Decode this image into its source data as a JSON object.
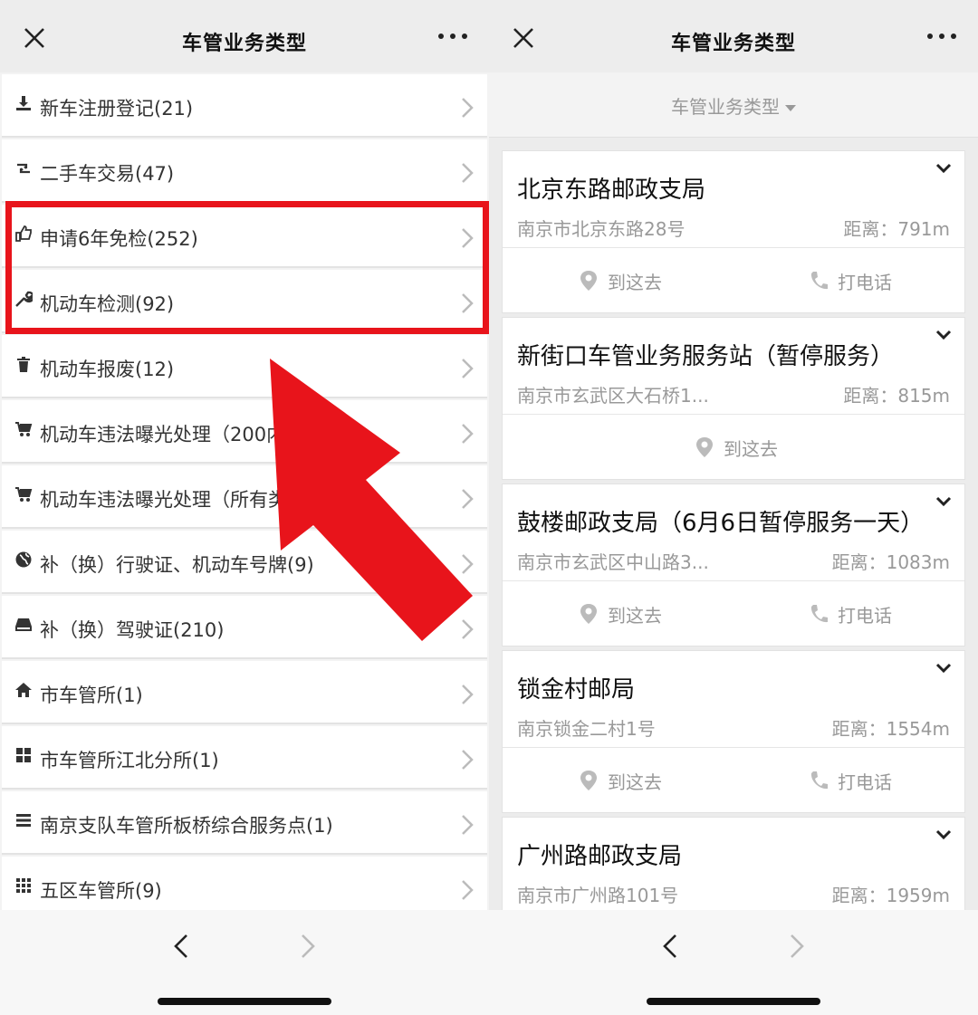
{
  "left": {
    "title": "车管业务类型",
    "items": [
      {
        "label": "新车注册登记(21)",
        "icon": "upload-icon"
      },
      {
        "label": "二手车交易(47)",
        "icon": "retweet-icon"
      },
      {
        "label": "申请6年免检(252)",
        "icon": "thumbs-up-icon"
      },
      {
        "label": "机动车检测(92)",
        "icon": "wrench-icon"
      },
      {
        "label": "机动车报废(12)",
        "icon": "trash-icon"
      },
      {
        "label": "机动车违法曝光处理（200内）(35)",
        "icon": "cart-icon"
      },
      {
        "label": "机动车违法曝光处理（所有类型）",
        "icon": "cart-icon"
      },
      {
        "label": "补（换）行驶证、机动车号牌(9)",
        "icon": "globe-icon"
      },
      {
        "label": "补（换）驾驶证(210)",
        "icon": "hdd-icon"
      },
      {
        "label": "市车管所(1)",
        "icon": "home-icon"
      },
      {
        "label": "市车管所江北分所(1)",
        "icon": "grid-icon"
      },
      {
        "label": "南京支队车管所板桥综合服务点(1)",
        "icon": "list-icon"
      },
      {
        "label": "五区车管所(9)",
        "icon": "grid-small-icon"
      }
    ]
  },
  "right": {
    "title": "车管业务类型",
    "filter_label": "车管业务类型",
    "go_label": "到这去",
    "call_label": "打电话",
    "cards": [
      {
        "name": "北京东路邮政支局",
        "address": "南京市北京东路28号",
        "distance": "距离：791m",
        "has_call": true
      },
      {
        "name": "新街口车管业务服务站（暂停服务）",
        "address": "南京市玄武区大石桥1...",
        "distance": "距离：815m",
        "has_call": false
      },
      {
        "name": "鼓楼邮政支局（6月6日暂停服务一天）",
        "address": "南京市玄武区中山路3...",
        "distance": "距离：1083m",
        "has_call": true
      },
      {
        "name": "锁金村邮局",
        "address": "南京锁金二村1号",
        "distance": "距离：1554m",
        "has_call": true
      },
      {
        "name": "广州路邮政支局",
        "address": "南京市广州路101号",
        "distance": "距离：1959m",
        "has_call": true
      }
    ]
  },
  "colors": {
    "highlight": "#e8141b",
    "arrow": "#e8141b",
    "background": "#ededed"
  }
}
